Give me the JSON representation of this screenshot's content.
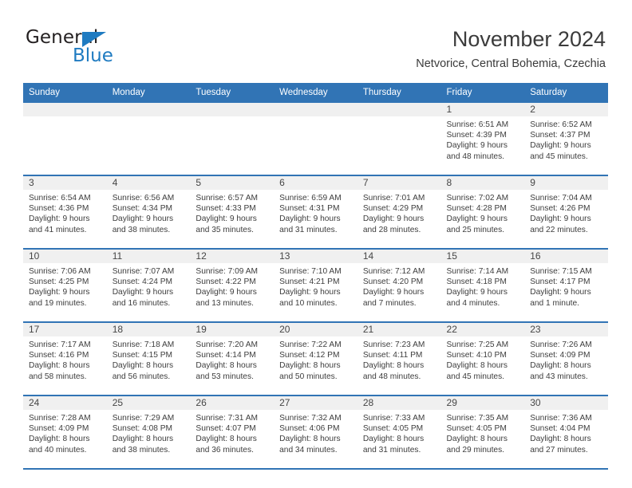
{
  "brand": {
    "name_top": "General",
    "name_bottom": "Blue",
    "triangle_color": "#1f7bc1",
    "text_color": "#231f20"
  },
  "header": {
    "title": "November 2024",
    "subtitle": "Netvorice, Central Bohemia, Czechia"
  },
  "theme": {
    "header_blue": "#3174b5",
    "daynum_band": "#f0f0f0",
    "body_text": "#3d3d3d"
  },
  "calendar": {
    "weekday_headers": [
      "Sunday",
      "Monday",
      "Tuesday",
      "Wednesday",
      "Thursday",
      "Friday",
      "Saturday"
    ],
    "weeks": [
      [
        {
          "day": "",
          "sunrise": "",
          "sunset": "",
          "daylight_line1": "",
          "daylight_line2": ""
        },
        {
          "day": "",
          "sunrise": "",
          "sunset": "",
          "daylight_line1": "",
          "daylight_line2": ""
        },
        {
          "day": "",
          "sunrise": "",
          "sunset": "",
          "daylight_line1": "",
          "daylight_line2": ""
        },
        {
          "day": "",
          "sunrise": "",
          "sunset": "",
          "daylight_line1": "",
          "daylight_line2": ""
        },
        {
          "day": "",
          "sunrise": "",
          "sunset": "",
          "daylight_line1": "",
          "daylight_line2": ""
        },
        {
          "day": "1",
          "sunrise": "Sunrise: 6:51 AM",
          "sunset": "Sunset: 4:39 PM",
          "daylight_line1": "Daylight: 9 hours",
          "daylight_line2": "and 48 minutes."
        },
        {
          "day": "2",
          "sunrise": "Sunrise: 6:52 AM",
          "sunset": "Sunset: 4:37 PM",
          "daylight_line1": "Daylight: 9 hours",
          "daylight_line2": "and 45 minutes."
        }
      ],
      [
        {
          "day": "3",
          "sunrise": "Sunrise: 6:54 AM",
          "sunset": "Sunset: 4:36 PM",
          "daylight_line1": "Daylight: 9 hours",
          "daylight_line2": "and 41 minutes."
        },
        {
          "day": "4",
          "sunrise": "Sunrise: 6:56 AM",
          "sunset": "Sunset: 4:34 PM",
          "daylight_line1": "Daylight: 9 hours",
          "daylight_line2": "and 38 minutes."
        },
        {
          "day": "5",
          "sunrise": "Sunrise: 6:57 AM",
          "sunset": "Sunset: 4:33 PM",
          "daylight_line1": "Daylight: 9 hours",
          "daylight_line2": "and 35 minutes."
        },
        {
          "day": "6",
          "sunrise": "Sunrise: 6:59 AM",
          "sunset": "Sunset: 4:31 PM",
          "daylight_line1": "Daylight: 9 hours",
          "daylight_line2": "and 31 minutes."
        },
        {
          "day": "7",
          "sunrise": "Sunrise: 7:01 AM",
          "sunset": "Sunset: 4:29 PM",
          "daylight_line1": "Daylight: 9 hours",
          "daylight_line2": "and 28 minutes."
        },
        {
          "day": "8",
          "sunrise": "Sunrise: 7:02 AM",
          "sunset": "Sunset: 4:28 PM",
          "daylight_line1": "Daylight: 9 hours",
          "daylight_line2": "and 25 minutes."
        },
        {
          "day": "9",
          "sunrise": "Sunrise: 7:04 AM",
          "sunset": "Sunset: 4:26 PM",
          "daylight_line1": "Daylight: 9 hours",
          "daylight_line2": "and 22 minutes."
        }
      ],
      [
        {
          "day": "10",
          "sunrise": "Sunrise: 7:06 AM",
          "sunset": "Sunset: 4:25 PM",
          "daylight_line1": "Daylight: 9 hours",
          "daylight_line2": "and 19 minutes."
        },
        {
          "day": "11",
          "sunrise": "Sunrise: 7:07 AM",
          "sunset": "Sunset: 4:24 PM",
          "daylight_line1": "Daylight: 9 hours",
          "daylight_line2": "and 16 minutes."
        },
        {
          "day": "12",
          "sunrise": "Sunrise: 7:09 AM",
          "sunset": "Sunset: 4:22 PM",
          "daylight_line1": "Daylight: 9 hours",
          "daylight_line2": "and 13 minutes."
        },
        {
          "day": "13",
          "sunrise": "Sunrise: 7:10 AM",
          "sunset": "Sunset: 4:21 PM",
          "daylight_line1": "Daylight: 9 hours",
          "daylight_line2": "and 10 minutes."
        },
        {
          "day": "14",
          "sunrise": "Sunrise: 7:12 AM",
          "sunset": "Sunset: 4:20 PM",
          "daylight_line1": "Daylight: 9 hours",
          "daylight_line2": "and 7 minutes."
        },
        {
          "day": "15",
          "sunrise": "Sunrise: 7:14 AM",
          "sunset": "Sunset: 4:18 PM",
          "daylight_line1": "Daylight: 9 hours",
          "daylight_line2": "and 4 minutes."
        },
        {
          "day": "16",
          "sunrise": "Sunrise: 7:15 AM",
          "sunset": "Sunset: 4:17 PM",
          "daylight_line1": "Daylight: 9 hours",
          "daylight_line2": "and 1 minute."
        }
      ],
      [
        {
          "day": "17",
          "sunrise": "Sunrise: 7:17 AM",
          "sunset": "Sunset: 4:16 PM",
          "daylight_line1": "Daylight: 8 hours",
          "daylight_line2": "and 58 minutes."
        },
        {
          "day": "18",
          "sunrise": "Sunrise: 7:18 AM",
          "sunset": "Sunset: 4:15 PM",
          "daylight_line1": "Daylight: 8 hours",
          "daylight_line2": "and 56 minutes."
        },
        {
          "day": "19",
          "sunrise": "Sunrise: 7:20 AM",
          "sunset": "Sunset: 4:14 PM",
          "daylight_line1": "Daylight: 8 hours",
          "daylight_line2": "and 53 minutes."
        },
        {
          "day": "20",
          "sunrise": "Sunrise: 7:22 AM",
          "sunset": "Sunset: 4:12 PM",
          "daylight_line1": "Daylight: 8 hours",
          "daylight_line2": "and 50 minutes."
        },
        {
          "day": "21",
          "sunrise": "Sunrise: 7:23 AM",
          "sunset": "Sunset: 4:11 PM",
          "daylight_line1": "Daylight: 8 hours",
          "daylight_line2": "and 48 minutes."
        },
        {
          "day": "22",
          "sunrise": "Sunrise: 7:25 AM",
          "sunset": "Sunset: 4:10 PM",
          "daylight_line1": "Daylight: 8 hours",
          "daylight_line2": "and 45 minutes."
        },
        {
          "day": "23",
          "sunrise": "Sunrise: 7:26 AM",
          "sunset": "Sunset: 4:09 PM",
          "daylight_line1": "Daylight: 8 hours",
          "daylight_line2": "and 43 minutes."
        }
      ],
      [
        {
          "day": "24",
          "sunrise": "Sunrise: 7:28 AM",
          "sunset": "Sunset: 4:09 PM",
          "daylight_line1": "Daylight: 8 hours",
          "daylight_line2": "and 40 minutes."
        },
        {
          "day": "25",
          "sunrise": "Sunrise: 7:29 AM",
          "sunset": "Sunset: 4:08 PM",
          "daylight_line1": "Daylight: 8 hours",
          "daylight_line2": "and 38 minutes."
        },
        {
          "day": "26",
          "sunrise": "Sunrise: 7:31 AM",
          "sunset": "Sunset: 4:07 PM",
          "daylight_line1": "Daylight: 8 hours",
          "daylight_line2": "and 36 minutes."
        },
        {
          "day": "27",
          "sunrise": "Sunrise: 7:32 AM",
          "sunset": "Sunset: 4:06 PM",
          "daylight_line1": "Daylight: 8 hours",
          "daylight_line2": "and 34 minutes."
        },
        {
          "day": "28",
          "sunrise": "Sunrise: 7:33 AM",
          "sunset": "Sunset: 4:05 PM",
          "daylight_line1": "Daylight: 8 hours",
          "daylight_line2": "and 31 minutes."
        },
        {
          "day": "29",
          "sunrise": "Sunrise: 7:35 AM",
          "sunset": "Sunset: 4:05 PM",
          "daylight_line1": "Daylight: 8 hours",
          "daylight_line2": "and 29 minutes."
        },
        {
          "day": "30",
          "sunrise": "Sunrise: 7:36 AM",
          "sunset": "Sunset: 4:04 PM",
          "daylight_line1": "Daylight: 8 hours",
          "daylight_line2": "and 27 minutes."
        }
      ]
    ]
  }
}
